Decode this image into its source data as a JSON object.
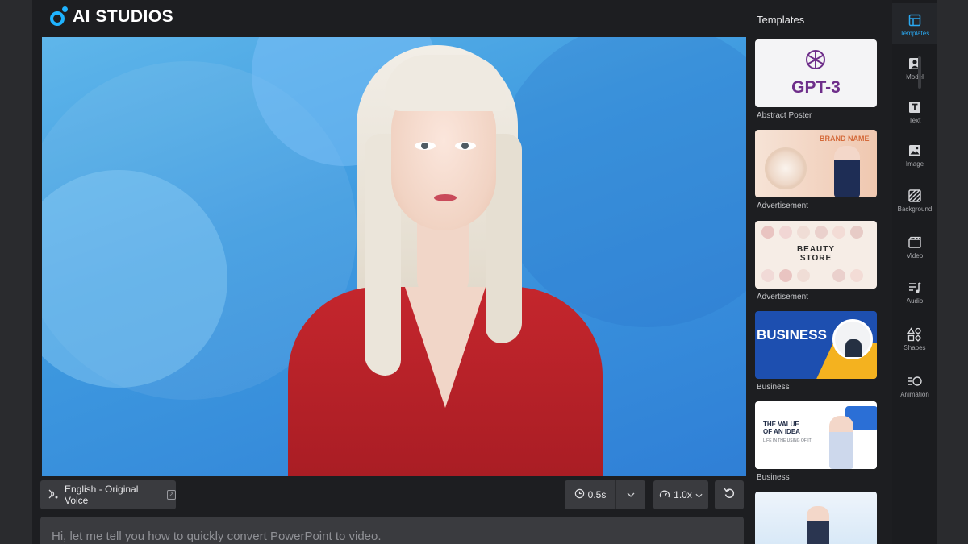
{
  "app": {
    "logo_text": "AI STUDIOS"
  },
  "canvas": {},
  "controls": {
    "voice_label": "English - Original Voice",
    "pause_value": "0.5s",
    "speed_value": "1.0x"
  },
  "script": {
    "text": "Hi, let me tell you how to quickly convert PowerPoint to video."
  },
  "templates": {
    "title": "Templates",
    "items": [
      {
        "label": "Abstract Poster",
        "thumb_text": "GPT-3"
      },
      {
        "label": "Advertisement",
        "thumb_text": "BRAND NAME"
      },
      {
        "label": "Advertisement",
        "thumb_text_line1": "BEAUTY",
        "thumb_text_line2": "STORE"
      },
      {
        "label": "Business",
        "thumb_text": "BUSINESS"
      },
      {
        "label": "Business",
        "thumb_text_line1": "THE VALUE",
        "thumb_text_line2": "OF AN IDEA",
        "thumb_sub": "LIFE IN THE USING OF IT"
      },
      {
        "label": ""
      }
    ]
  },
  "tools": [
    {
      "label": "Templates",
      "icon": "layout-icon",
      "active": true
    },
    {
      "label": "Model",
      "icon": "person-icon"
    },
    {
      "label": "Text",
      "icon": "text-icon"
    },
    {
      "label": "Image",
      "icon": "image-icon"
    },
    {
      "label": "Background",
      "icon": "background-icon"
    },
    {
      "label": "Video",
      "icon": "video-icon"
    },
    {
      "label": "Audio",
      "icon": "audio-icon"
    },
    {
      "label": "Shapes",
      "icon": "shapes-icon"
    },
    {
      "label": "Animation",
      "icon": "animation-icon"
    }
  ],
  "colors": {
    "accent": "#2aa9f2",
    "panel": "#1d1e21",
    "control": "#3a3b3f"
  }
}
